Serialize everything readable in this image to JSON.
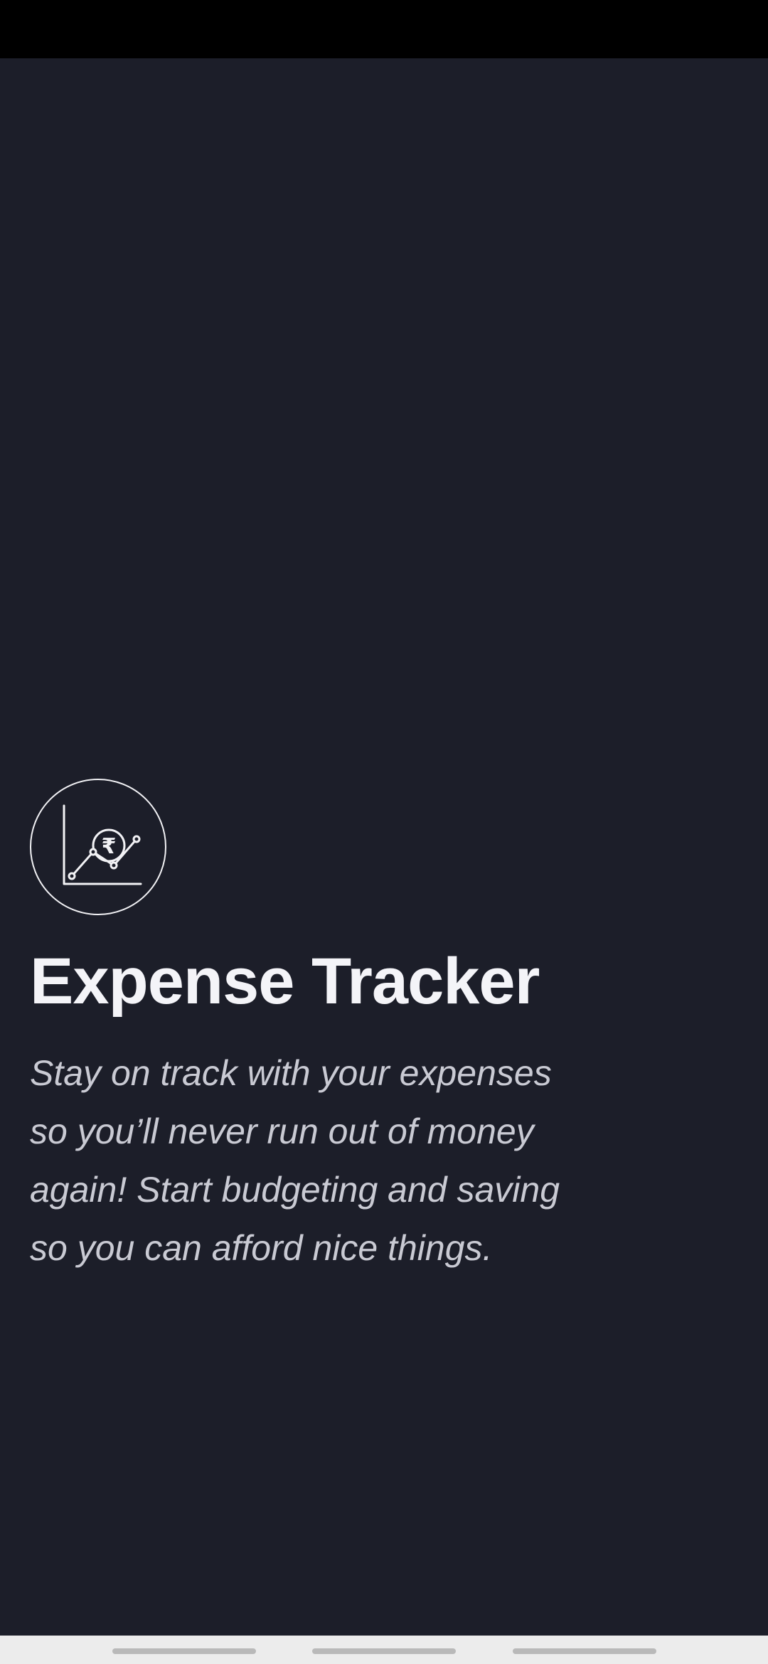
{
  "app": {
    "title": "Expense Tracker",
    "tagline": "Stay on track with your expenses so you’ll never run out of money again! Start budgeting and saving so you can afford nice things.",
    "icon": "rupee-chart-icon",
    "icon_glyph": "₹"
  },
  "colors": {
    "background": "#1c1e29",
    "status_bar": "#000000",
    "title_text": "#f4f4f8",
    "tagline_text": "#c9cad3",
    "nav_bar": "#ececec"
  },
  "nav_bar": {
    "handles": [
      "nav-handle-left",
      "nav-handle-center",
      "nav-handle-right"
    ]
  }
}
